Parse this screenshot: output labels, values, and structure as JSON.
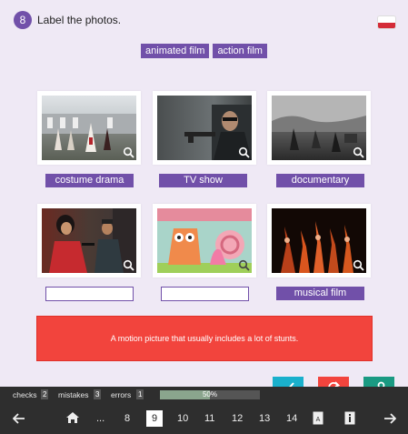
{
  "task": {
    "number": "8",
    "title": "Label the photos."
  },
  "word_bank": [
    "animated film",
    "action film"
  ],
  "photos": [
    {
      "label": "costume drama",
      "filled": true
    },
    {
      "label": "TV show",
      "filled": true
    },
    {
      "label": "documentary",
      "filled": true
    },
    {
      "label": "",
      "filled": false
    },
    {
      "label": "",
      "filled": false
    },
    {
      "label": "musical film",
      "filled": true
    }
  ],
  "hint": "A motion picture that usually includes a lot of stunts.",
  "stats": {
    "checks_label": "checks",
    "checks": "2",
    "mistakes_label": "mistakes",
    "mistakes": "3",
    "errors_label": "errors",
    "errors": "1",
    "progress_text": "50%",
    "progress": 0.5
  },
  "nav": {
    "ellipsis": "...",
    "pages": [
      "8",
      "9",
      "10",
      "11",
      "12",
      "13",
      "14"
    ],
    "current": "9"
  },
  "colors": {
    "accent": "#7150a9",
    "hint": "#f2443d",
    "check": "#1ab0cc",
    "retry": "#f2443d",
    "key": "#1a9a82"
  },
  "icons": [
    "zoom-icon",
    "check-icon",
    "retry-icon",
    "key-icon",
    "home-icon",
    "arrow-left-icon",
    "arrow-right-icon",
    "vocabulary-icon",
    "info-icon"
  ]
}
